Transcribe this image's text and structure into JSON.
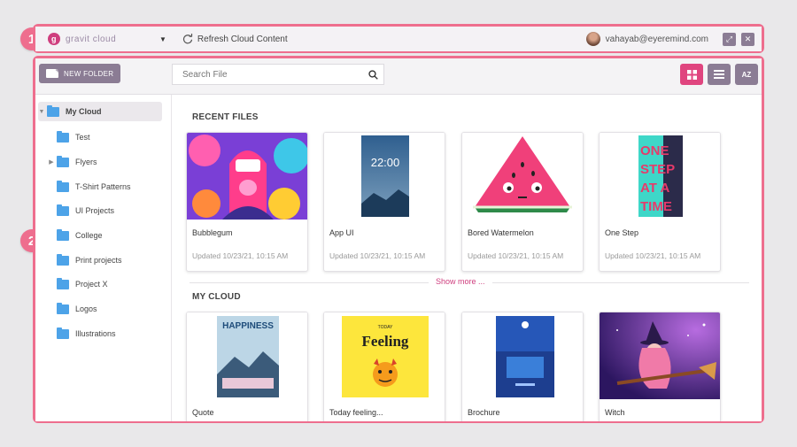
{
  "callouts": {
    "one": "1",
    "two": "2"
  },
  "topbar": {
    "brand": "gravit cloud",
    "brand_logo": "g",
    "refresh_label": "Refresh Cloud Content",
    "user_email": "vahayab@eyeremind.com"
  },
  "toolbar": {
    "new_folder_label": "NEW FOLDER",
    "search_placeholder": "Search File",
    "sort_label": "AZ"
  },
  "sidebar": {
    "root": "My Cloud",
    "items": [
      {
        "label": "Test",
        "expandable": false
      },
      {
        "label": "Flyers",
        "expandable": true
      },
      {
        "label": "T-Shirt Patterns",
        "expandable": false
      },
      {
        "label": "UI Projects",
        "expandable": false
      },
      {
        "label": "College",
        "expandable": false
      },
      {
        "label": "Print projects",
        "expandable": false
      },
      {
        "label": "Project X",
        "expandable": false
      },
      {
        "label": "Logos",
        "expandable": false
      },
      {
        "label": "Illustrations",
        "expandable": false
      }
    ]
  },
  "recent": {
    "title": "RECENT FILES",
    "files": [
      {
        "name": "Bubblegum",
        "updated": "Updated 10/23/21, 10:15 AM"
      },
      {
        "name": "App  UI",
        "updated": "Updated 10/23/21, 10:15 AM",
        "thumb_text": "22:00"
      },
      {
        "name": "Bored Watermelon",
        "updated": "Updated 10/23/21, 10:15 AM"
      },
      {
        "name": "One Step",
        "updated": "Updated 10/23/21, 10:15 AM",
        "thumb_text": "ONE STEP AT A TIME"
      }
    ]
  },
  "show_more": "Show more ...",
  "mycloud": {
    "title": "MY CLOUD",
    "files": [
      {
        "name": "Quote",
        "thumb_text": "HAPPINESS"
      },
      {
        "name": "Today feeling...",
        "thumb_text": "Feeling",
        "thumb_sub": "TODAY"
      },
      {
        "name": "Brochure"
      },
      {
        "name": "Witch"
      }
    ]
  },
  "colors": {
    "accent": "#e0457f",
    "callout": "#ee6e8e",
    "button": "#8b7c94",
    "folder": "#4da3e8"
  }
}
